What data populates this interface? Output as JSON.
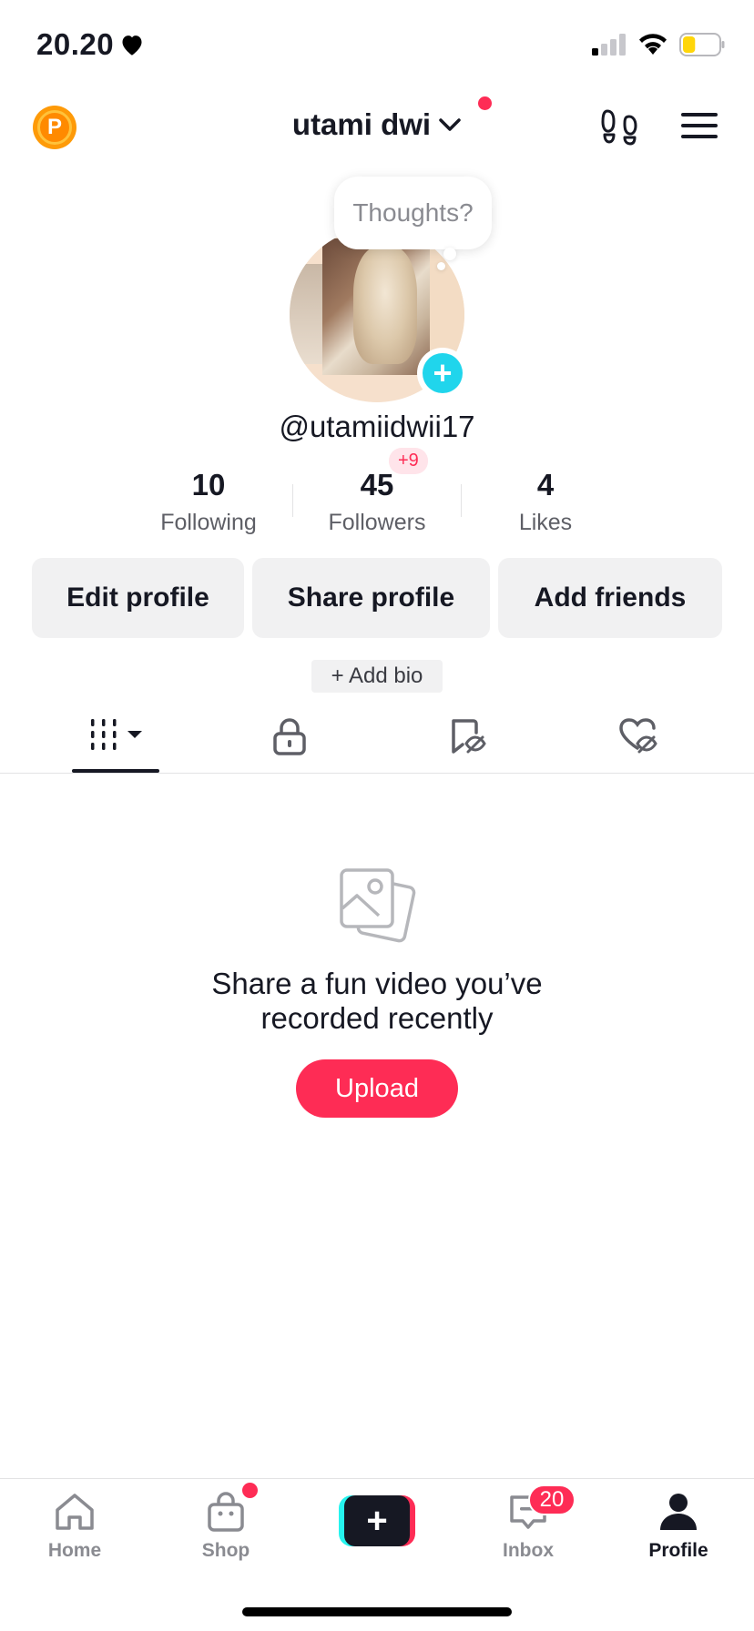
{
  "status_bar": {
    "time": "20.20",
    "signal": "signal-bars-icon",
    "wifi": "wifi-icon",
    "battery_level": 0.35,
    "battery_color": "#ffd60a"
  },
  "header": {
    "coin_letter": "P",
    "title": "utami dwi",
    "accent": "#fe2c55"
  },
  "profile": {
    "thought_placeholder": "Thoughts?",
    "handle": "@utamiidwii17",
    "stats": [
      {
        "value": "10",
        "label": "Following"
      },
      {
        "value": "45",
        "label": "Followers",
        "badge": "+9"
      },
      {
        "value": "4",
        "label": "Likes"
      }
    ],
    "buttons": {
      "edit": "Edit profile",
      "share": "Share profile",
      "add_friends": "Add friends"
    },
    "add_bio": "+ Add bio"
  },
  "tabs": [
    {
      "icon": "videos-grid-icon",
      "active": true
    },
    {
      "icon": "lock-icon",
      "active": false
    },
    {
      "icon": "bookmark-hidden-icon",
      "active": false
    },
    {
      "icon": "heart-hidden-icon",
      "active": false
    }
  ],
  "empty_state": {
    "message_line1": "Share a fun video you’ve",
    "message_line2": "recorded recently",
    "upload_label": "Upload"
  },
  "bottom_nav": {
    "home": "Home",
    "shop": "Shop",
    "inbox": "Inbox",
    "inbox_count": "20",
    "profile": "Profile"
  },
  "colors": {
    "primary_red": "#fe2c55",
    "cyan": "#25f4ee",
    "text": "#161823",
    "muted": "#8a8b91"
  }
}
